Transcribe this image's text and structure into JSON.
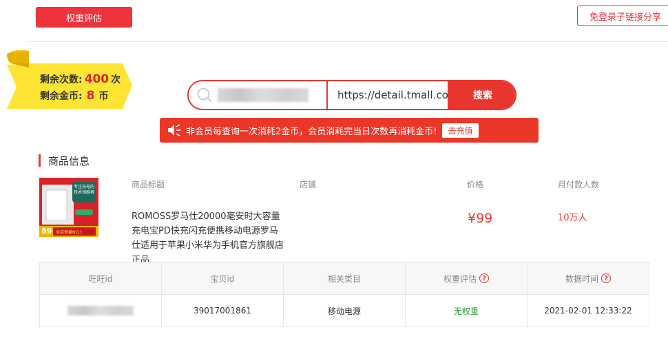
{
  "toolbar": {
    "eval_label": "权重评估",
    "share_label": "免登录子链接分享"
  },
  "quota": {
    "times_label": "剩余次数:",
    "times_value": "400",
    "times_unit": "次",
    "coins_label": "剩余金币:",
    "coins_value": "8",
    "coins_unit": "币"
  },
  "search": {
    "url_value": "https://detail.tmall.com",
    "button_label": "搜索"
  },
  "notice": {
    "text": "非会员每查询一次消耗2金币，会员消耗完当日次数再消耗金币!",
    "recharge_label": "去充值"
  },
  "section": {
    "title": "商品信息"
  },
  "product": {
    "headers": {
      "title": "商品标题",
      "shop": "店铺",
      "price": "价格",
      "monthly": "月付款人数"
    },
    "title": "ROMOSS罗马仕20000毫安时大容量充电宝PD快充闪充便携移动电源罗马 仕适用于苹果小米华为手机官方旗舰店正品",
    "price": "¥99",
    "monthly_sales": "10万人",
    "thumb_badge_text": "专注充电的技术领跑者",
    "thumb_price_text": "89",
    "thumb_footer_text": "全店销量NO.1"
  },
  "table": {
    "headers": [
      "旺旺id",
      "宝贝id",
      "相关类目",
      "权重评估",
      "数据时间"
    ],
    "row": {
      "item_id": "39017001861",
      "category": "移动电源",
      "weight": "无权重",
      "time": "2021-02-01 12:33:22"
    }
  },
  "colors": {
    "accent": "#e8362e",
    "ribbon": "#ffe533",
    "good": "#1a9b2c"
  }
}
